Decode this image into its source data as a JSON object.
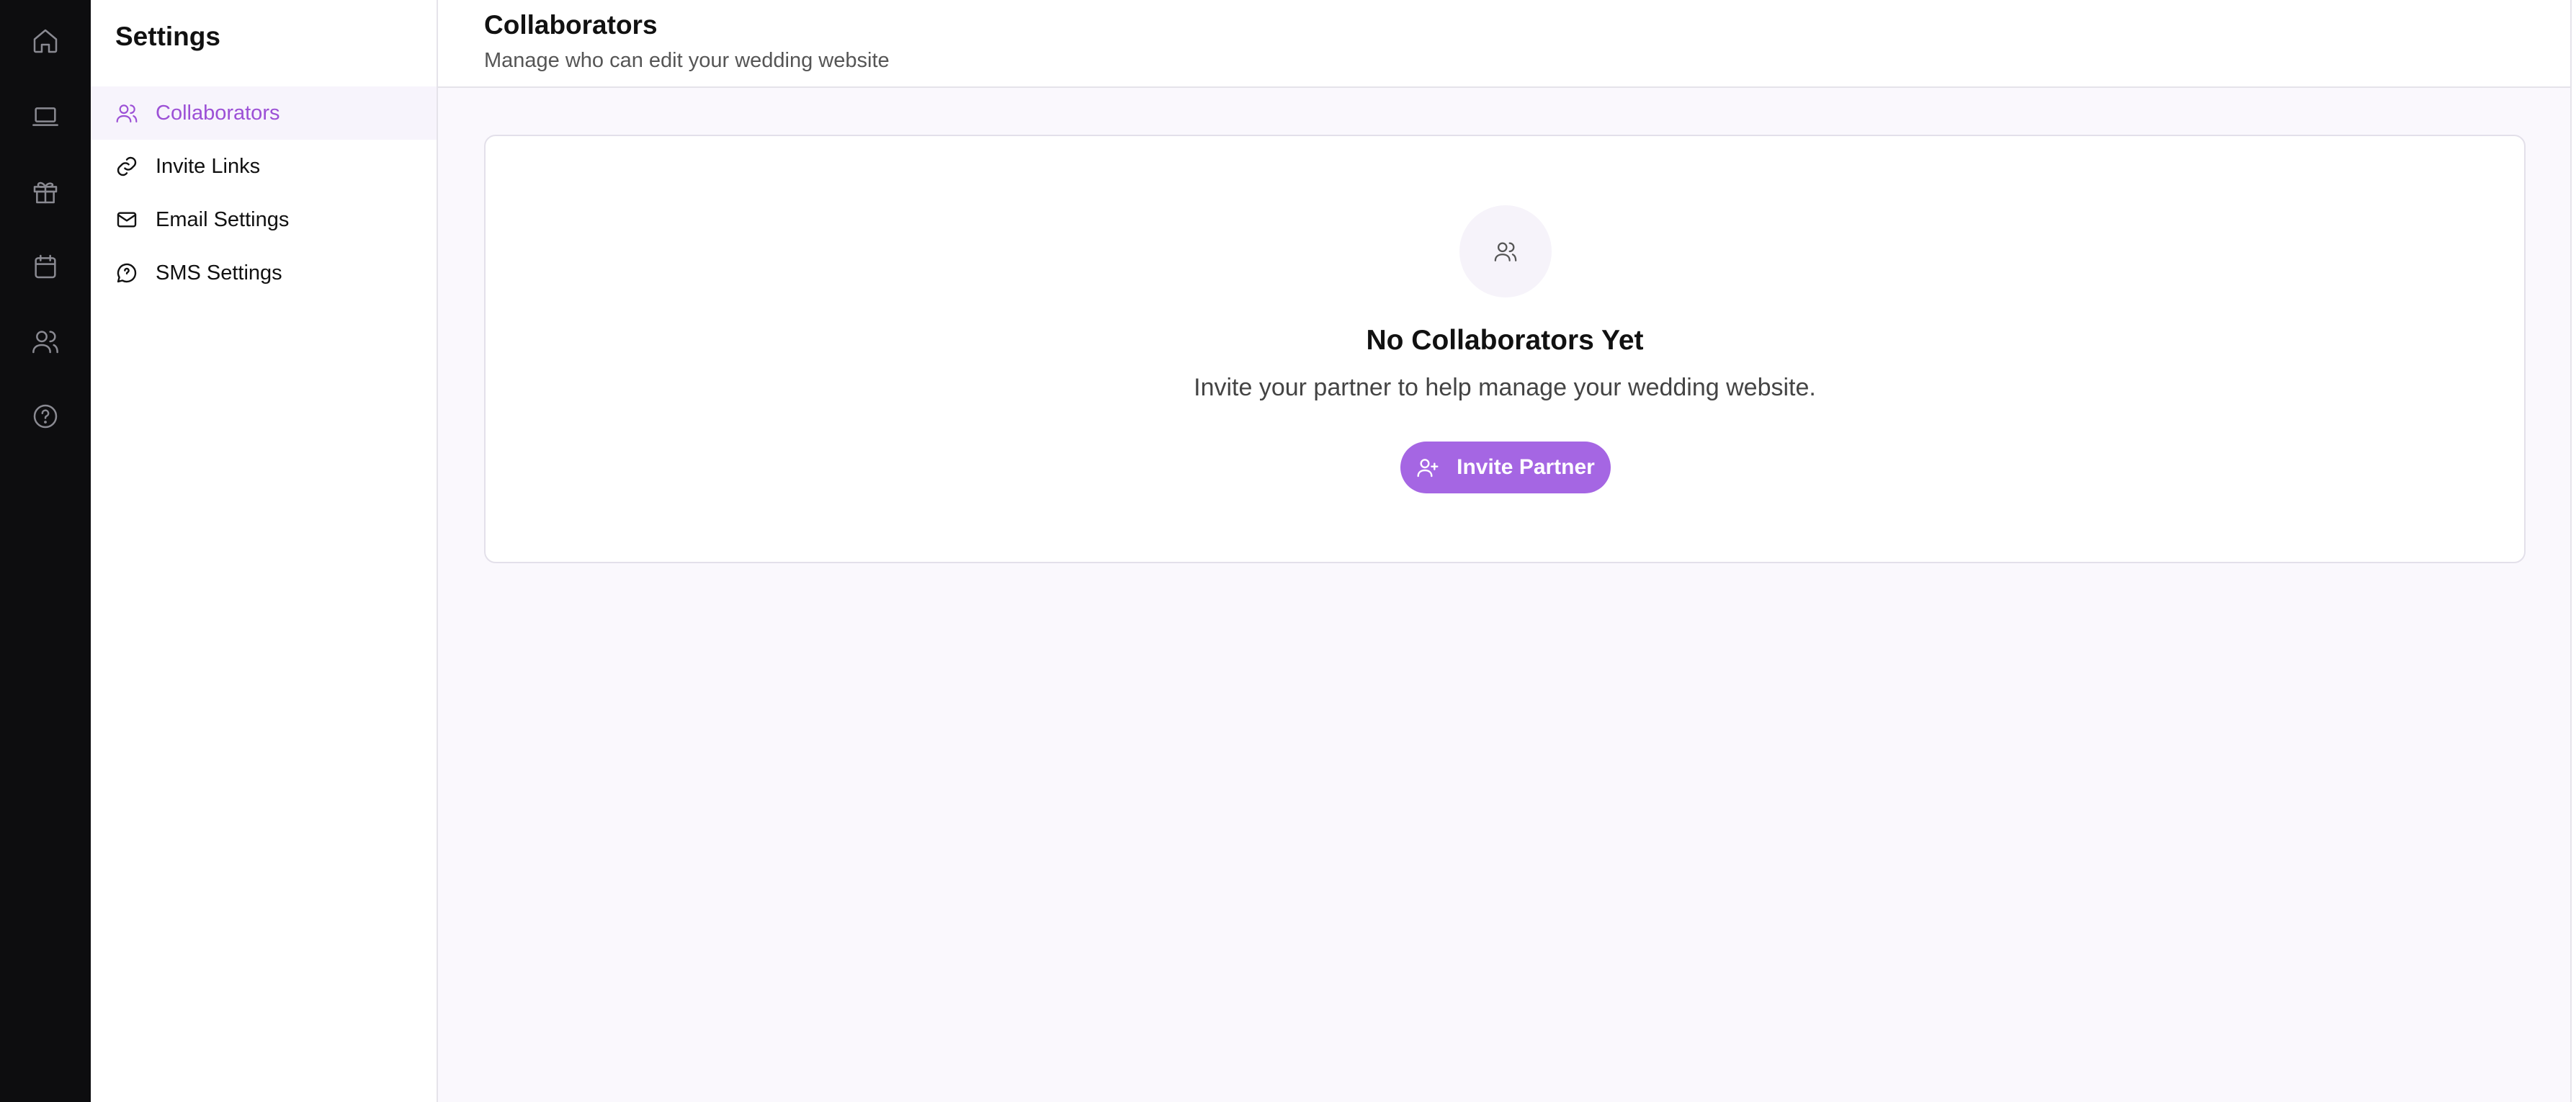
{
  "rail": {
    "icons": [
      "home-icon",
      "laptop-icon",
      "gift-icon",
      "calendar-icon",
      "users-icon",
      "help-circle-icon"
    ]
  },
  "sidebar": {
    "title": "Settings",
    "items": [
      {
        "label": "Collaborators",
        "icon": "users-icon",
        "active": true
      },
      {
        "label": "Invite Links",
        "icon": "link-icon",
        "active": false
      },
      {
        "label": "Email Settings",
        "icon": "mail-icon",
        "active": false
      },
      {
        "label": "SMS Settings",
        "icon": "message-circle-icon",
        "active": false
      }
    ]
  },
  "header": {
    "title": "Collaborators",
    "subtitle": "Manage who can edit your wedding website"
  },
  "empty_state": {
    "icon": "users-icon",
    "title": "No Collaborators Yet",
    "text": "Invite your partner to help manage your wedding website.",
    "button_label": "Invite Partner",
    "button_icon": "user-plus-icon"
  },
  "colors": {
    "accent": "#a566e3",
    "accent_text": "#9c50d6",
    "rail_bg": "#0d0d0f",
    "page_bg": "#faf8fd"
  }
}
